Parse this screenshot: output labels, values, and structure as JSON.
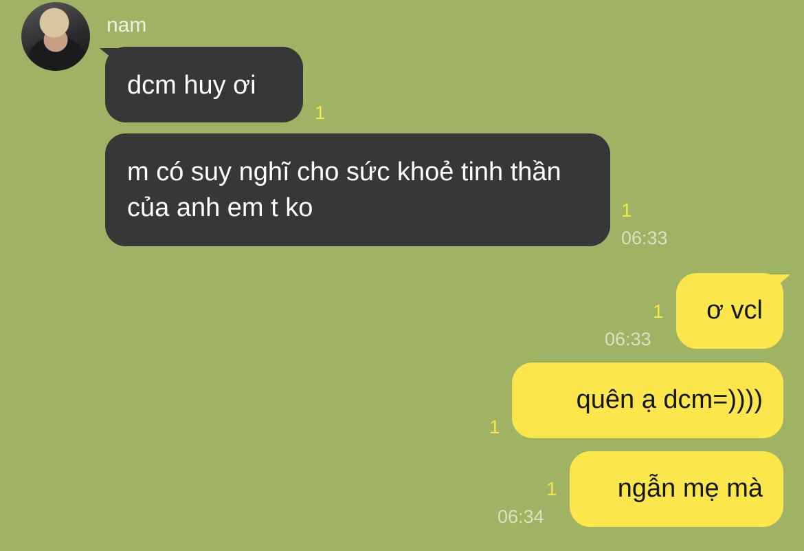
{
  "chat": {
    "sender_name": "nam",
    "messages": [
      {
        "text": "dcm huy ơi",
        "read_count": "1",
        "time": ""
      },
      {
        "text": "m có suy nghĩ cho sức khoẻ tinh thần của anh em t ko",
        "read_count": "1",
        "time": "06:33"
      },
      {
        "text": "ơ vcl",
        "read_count": "1",
        "time": "06:33"
      },
      {
        "text": "quên ạ dcm=))))",
        "read_count": "1",
        "time": ""
      },
      {
        "text": "ngẫn mẹ mà",
        "read_count": "1",
        "time": "06:34"
      }
    ]
  },
  "colors": {
    "background": "#a0b263",
    "incoming_bubble": "#373737",
    "outgoing_bubble": "#fbe74c",
    "read_count": "#f5e64a"
  }
}
